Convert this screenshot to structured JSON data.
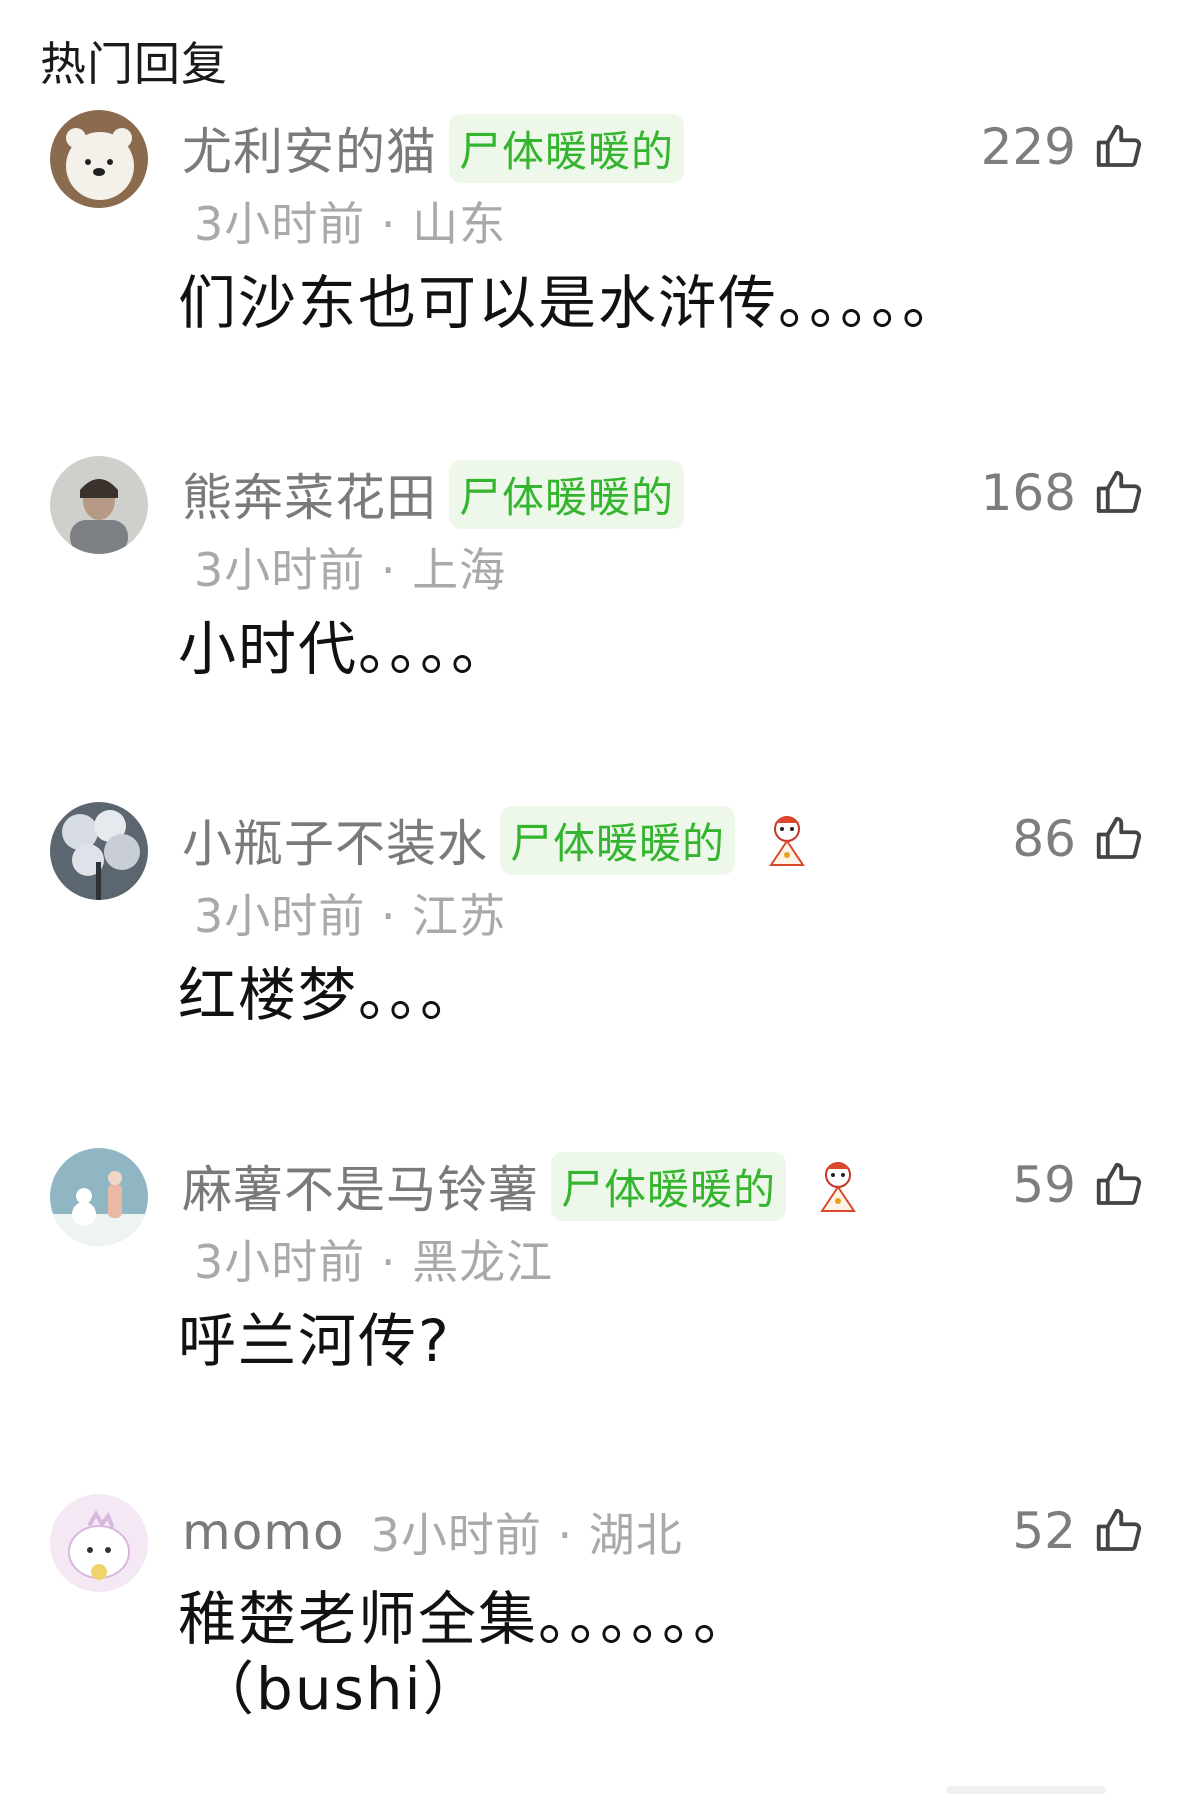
{
  "section_title": "热门回复",
  "comments": [
    {
      "username": "尤利安的猫",
      "badge": "尸体暖暖的",
      "time": "3小时前",
      "location": "山东",
      "text": "们沙东也可以是水浒传。。。。。",
      "likes": "229",
      "avatar_icon": "polar-bear-avatar"
    },
    {
      "username": "熊奔菜花田",
      "badge": "尸体暖暖的",
      "time": "3小时前",
      "location": "上海",
      "text": "小时代。。。。",
      "likes": "168",
      "avatar_icon": "person-photo-avatar"
    },
    {
      "username": "小瓶子不装水",
      "badge": "尸体暖暖的",
      "time": "3小时前",
      "location": "江苏",
      "text": "红楼梦。。。",
      "likes": "86",
      "avatar_icon": "cherry-blossom-avatar"
    },
    {
      "username": "麻薯不是马铃薯",
      "badge": "尸体暖暖的",
      "time": "3小时前",
      "location": "黑龙江",
      "text": "呼兰河传?",
      "likes": "59",
      "avatar_icon": "snowman-avatar"
    },
    {
      "username": "momo",
      "time": "3小时前",
      "location": "湖北",
      "text": "稚楚老师全集。。。。。。",
      "text_line2": "（bushi）",
      "likes": "52",
      "avatar_icon": "pink-cartoon-avatar"
    }
  ],
  "meta_separator": "·",
  "colors": {
    "badge_bg": "#eef8ea",
    "badge_text": "#35b52f",
    "username": "#7a7a7a",
    "meta": "#a9a9a9"
  }
}
